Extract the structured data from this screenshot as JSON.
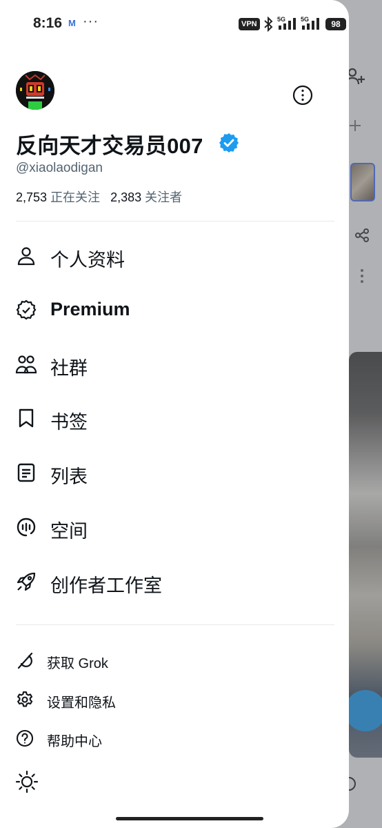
{
  "status_bar": {
    "time": "8:16",
    "app_icon": "M",
    "overflow": "···",
    "vpn": "VPN",
    "signal_1": "5G",
    "signal_2": "5G",
    "battery": "98"
  },
  "profile": {
    "name": "反向天才交易员007",
    "handle": "@xiaolaodigan",
    "following_count": "2,753",
    "following_label": "正在关注",
    "followers_count": "2,383",
    "followers_label": "关注者",
    "verified": true
  },
  "menu": {
    "items": [
      {
        "label": "个人资料",
        "icon": "person-icon"
      },
      {
        "label": "Premium",
        "icon": "premium-badge-icon"
      },
      {
        "label": "社群",
        "icon": "communities-icon"
      },
      {
        "label": "书签",
        "icon": "bookmark-icon"
      },
      {
        "label": "列表",
        "icon": "list-icon"
      },
      {
        "label": "空间",
        "icon": "spaces-icon"
      },
      {
        "label": "创作者工作室",
        "icon": "rocket-icon"
      }
    ]
  },
  "secondary": {
    "items": [
      {
        "label": "获取 Grok",
        "icon": "grok-icon"
      },
      {
        "label": "设置和隐私",
        "icon": "gear-icon"
      },
      {
        "label": "帮助中心",
        "icon": "help-icon"
      }
    ]
  },
  "colors": {
    "verified": "#1d9bf0",
    "text_primary": "#0f1419",
    "text_secondary": "#536471",
    "divider": "#e7e9ea"
  }
}
